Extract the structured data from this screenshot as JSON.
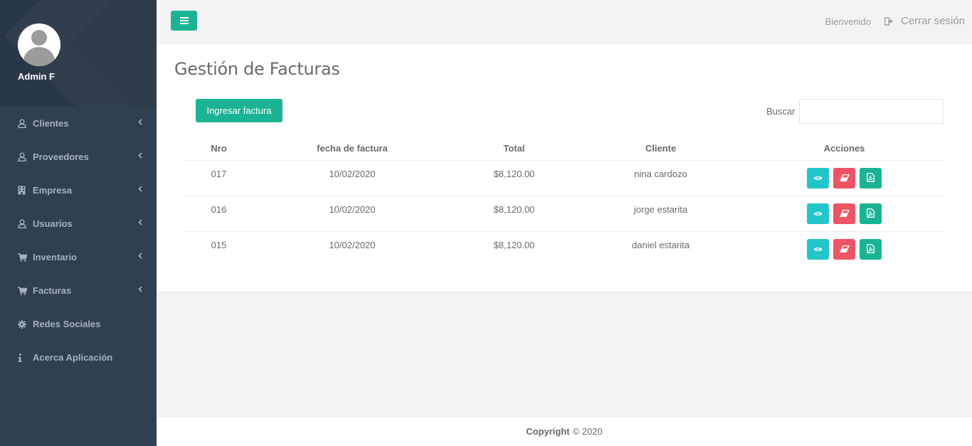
{
  "user": {
    "name": "Admin F"
  },
  "sidebar": {
    "items": [
      {
        "label": "Clientes",
        "icon": "user-icon",
        "has_arrow": true
      },
      {
        "label": "Proveedores",
        "icon": "user-icon",
        "has_arrow": true
      },
      {
        "label": "Empresa",
        "icon": "building-icon",
        "has_arrow": true
      },
      {
        "label": "Usuarios",
        "icon": "user-icon",
        "has_arrow": true
      },
      {
        "label": "Inventario",
        "icon": "cart-icon",
        "has_arrow": true
      },
      {
        "label": "Facturas",
        "icon": "cart-icon",
        "has_arrow": true
      },
      {
        "label": "Redes Sociales",
        "icon": "gear-icon",
        "has_arrow": false
      },
      {
        "label": "Acerca Aplicación",
        "icon": "info-icon",
        "has_arrow": false
      }
    ]
  },
  "topbar": {
    "welcome": "Bienvenido",
    "logout": "Cerrar sesión"
  },
  "page": {
    "title": "Gestión de Facturas",
    "add_button": "Ingresar factura",
    "search_label": "Buscar",
    "search_value": ""
  },
  "table": {
    "headers": [
      "Nro",
      "fecha de factura",
      "Total",
      "Cliente",
      "Acciones"
    ],
    "rows": [
      {
        "nro": "017",
        "fecha": "10/02/2020",
        "total": "$8,120.00",
        "cliente": "nina cardozo"
      },
      {
        "nro": "016",
        "fecha": "10/02/2020",
        "total": "$8,120.00",
        "cliente": "jorge estarita"
      },
      {
        "nro": "015",
        "fecha": "10/02/2020",
        "total": "$8,120.00",
        "cliente": "daniel estarita"
      }
    ]
  },
  "footer": {
    "copyright_bold": "Copyright",
    "copyright_rest": "© 2020"
  },
  "colors": {
    "primary": "#1ab394",
    "info": "#23c6c8",
    "danger": "#ed5565",
    "sidebar": "#2f4050"
  }
}
